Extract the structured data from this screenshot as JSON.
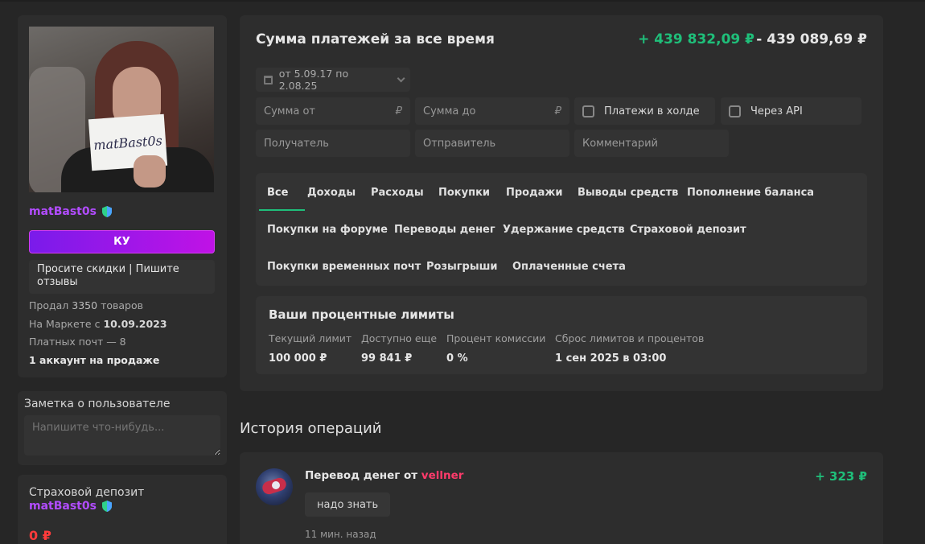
{
  "profile": {
    "avatar_sign_text": "matBast0s",
    "username": "matBast0s",
    "button_label": "КУ",
    "status": "Просите скидки | Пишите отзывы",
    "stats": {
      "sold_prefix": "Продал",
      "sold_count": "3350",
      "sold_suffix": "товаров",
      "market_prefix": "На Маркете с",
      "market_date": "10.09.2023",
      "paid_mail": "Платных почт — 8",
      "accounts": "1 аккаунт на продаже"
    },
    "username_color": "#b24cff"
  },
  "note": {
    "title": "Заметка о пользователе",
    "placeholder": "Напишите что-нибудь..."
  },
  "deposit": {
    "title": "Страховой депозит",
    "username": "matBast0s",
    "amount": "0 ₽"
  },
  "payments": {
    "title": "Сумма платежей за все время",
    "income": "+ 439 832,09 ₽",
    "outcome": "- 439 089,69 ₽",
    "date_range": "от 5.09.17 по 2.08.25",
    "filters": {
      "amount_from": "Сумма от",
      "amount_to": "Сумма до",
      "rub": "₽",
      "hold_label": "Платежи в холде",
      "api_label": "Через API",
      "recipient": "Получатель",
      "sender": "Отправитель",
      "comment": "Комментарий"
    },
    "tabs": [
      "Все",
      "Доходы",
      "Расходы",
      "Покупки",
      "Продажи",
      "Выводы средств",
      "Пополнение баланса",
      "Покупки на форуме",
      "Переводы денег",
      "Удержание средств",
      "Страховой депозит",
      "Покупки временных почт",
      "Розыгрыши",
      "Оплаченные счета"
    ],
    "active_tab": "Все"
  },
  "limits": {
    "title": "Ваши процентные лимиты",
    "labels": [
      "Текущий лимит",
      "Доступно еще",
      "Процент комиссии",
      "Сброс лимитов и процентов"
    ],
    "values": [
      "100 000 ₽",
      "99 841 ₽",
      "0 %",
      "1 сен 2025 в 03:00"
    ]
  },
  "history": {
    "title": "История операций",
    "operations": [
      {
        "title_prefix": "Перевод денег от",
        "from_user": "vellner",
        "amount": "+ 323 ₽",
        "comment": "надо знать",
        "time": "11 мин. назад"
      }
    ]
  },
  "colors": {
    "accent_green": "#1fbf7a",
    "accent_purple": "#b24cff",
    "danger_red": "#ff3b3b",
    "user_pink": "#ff3b6b"
  }
}
